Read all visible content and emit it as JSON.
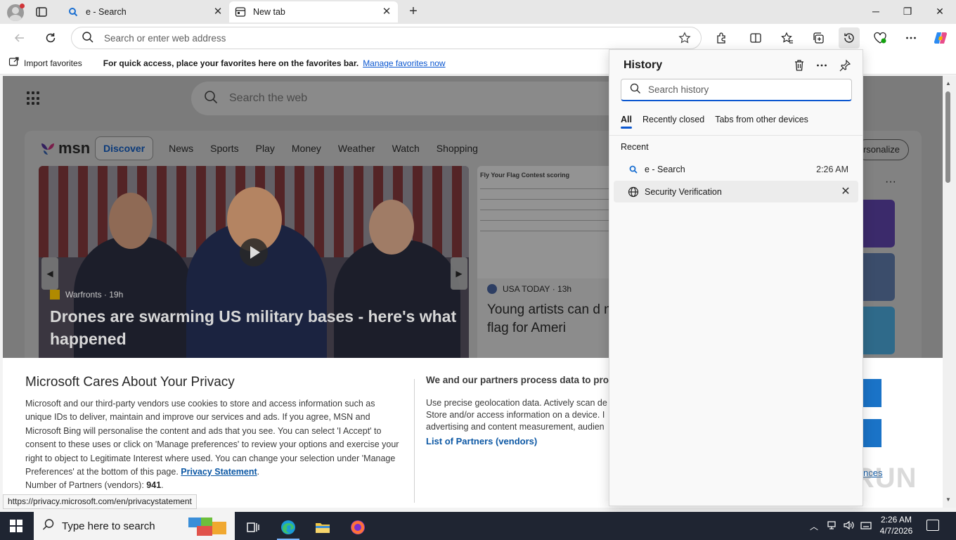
{
  "browser": {
    "tabs": [
      {
        "title": "e - Search",
        "active": false
      },
      {
        "title": "New tab",
        "active": true
      }
    ],
    "address_placeholder": "Search or enter web address",
    "favorites_bar": {
      "import_label": "Import favorites",
      "message": "For quick access, place your favorites here on the favorites bar.",
      "manage_link": "Manage favorites now"
    },
    "status_url": "https://privacy.microsoft.com/en/privacystatement"
  },
  "page": {
    "search_placeholder": "Search the web",
    "msn": {
      "logo": "msn",
      "nav": [
        "Discover",
        "News",
        "Sports",
        "Play",
        "Money",
        "Weather",
        "Watch",
        "Shopping"
      ],
      "personalize": "rsonalize",
      "hero": {
        "source": "Warfronts",
        "age": "19h",
        "title": "Drones are swarming US military bases - here's what happened"
      },
      "article2": {
        "doc_title": "Fly Your Flag Contest scoring",
        "source": "USA TODAY",
        "age": "13h",
        "title": "Young artists can d new flag for Ameri"
      }
    },
    "privacy": {
      "title": "Microsoft Cares About Your Privacy",
      "body": "Microsoft and our third-party vendors use cookies to store and access information such as unique IDs to deliver, maintain and improve our services and ads. If you agree, MSN and Microsoft Bing will personalise the content and ads that you see. You can select 'I Accept' to consent to these uses or click on 'Manage preferences' to review your options and exercise your right to object to Legitimate Interest where used.  You can change your selection under 'Manage Preferences' at the bottom of this page.",
      "statement_link": "Privacy Statement",
      "partners_label": "Number of Partners (vendors):",
      "partners_count": "941",
      "right_title": "We and our partners process data to pro",
      "right_body_1": "Use precise geolocation data. Actively scan de",
      "right_body_2": "Store and/or access information on a device. I",
      "right_body_3": "advertising and content measurement, audien",
      "partners_link": "List of Partners (vendors)",
      "preferences_link": "nces"
    },
    "watermark": "ANY RUN"
  },
  "history": {
    "title": "History",
    "search_placeholder": "Search history",
    "tabs": [
      "All",
      "Recently closed",
      "Tabs from other devices"
    ],
    "section": "Recent",
    "items": [
      {
        "title": "e - Search",
        "time": "2:26 AM",
        "icon": "search-icon"
      },
      {
        "title": "Security Verification",
        "time": "",
        "icon": "globe-icon"
      }
    ]
  },
  "taskbar": {
    "search_placeholder": "Type here to search",
    "time": "2:26 AM",
    "date": "4/7/2026"
  },
  "colors": {
    "accent": "#0b57d0",
    "taskbar": "#1f2532",
    "privacy_button": "#1a73c7"
  }
}
